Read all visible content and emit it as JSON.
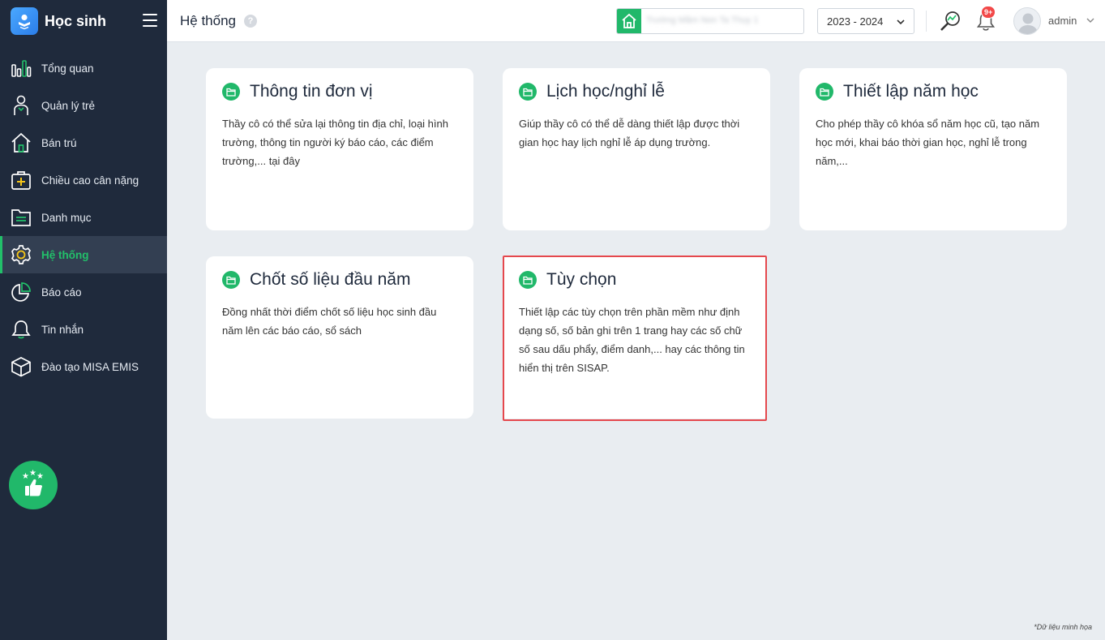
{
  "app": {
    "title": "Học sinh"
  },
  "sidebar": {
    "items": [
      {
        "label": "Tổng quan",
        "icon": "chart-bars-icon"
      },
      {
        "label": "Quản lý trẻ",
        "icon": "child-icon"
      },
      {
        "label": "Bán trú",
        "icon": "house-icon"
      },
      {
        "label": "Chiều cao cân nặng",
        "icon": "medical-kit-icon"
      },
      {
        "label": "Danh mục",
        "icon": "folder-list-icon"
      },
      {
        "label": "Hệ thống",
        "icon": "gear-icon",
        "active": true
      },
      {
        "label": "Báo cáo",
        "icon": "pie-chart-icon"
      },
      {
        "label": "Tin nhắn",
        "icon": "bell-icon"
      },
      {
        "label": "Đào tạo MISA EMIS",
        "icon": "cube-icon"
      }
    ]
  },
  "header": {
    "title": "Hệ thống",
    "help": "?",
    "school_name": "Trường Mầm Non Ta Thụy 1",
    "year": "2023 - 2024",
    "notification_badge": "9+",
    "user": "admin"
  },
  "cards": [
    {
      "title": "Thông tin đơn vị",
      "desc": "Thầy cô có thể sửa lại thông tin địa chỉ, loại hình trường, thông tin người ký báo cáo, các điểm trường,... tại đây"
    },
    {
      "title": "Lịch học/nghỉ lễ",
      "desc": "Giúp thầy cô có thể dễ dàng thiết lập được thời gian học hay lịch nghỉ lễ áp dụng trường."
    },
    {
      "title": "Thiết lập năm học",
      "desc": "Cho phép thầy cô khóa sổ năm học cũ, tạo năm học mới, khai báo thời gian học, nghỉ lễ trong năm,..."
    },
    {
      "title": "Chốt số liệu đầu năm",
      "desc": "Đồng nhất thời điểm chốt số liệu học sinh đầu năm lên các báo cáo, sổ sách"
    },
    {
      "title": "Tùy chọn",
      "desc": "Thiết lập các tùy chọn trên phần mềm như định dạng số, số bản ghi trên 1 trang hay các số chữ số sau dấu phẩy, điểm danh,... hay các thông tin hiển thị trên SISAP."
    }
  ],
  "footnote": "*Dữ liệu minh họa",
  "colors": {
    "sidebar_bg": "#1f2a3c",
    "accent": "#21b86a",
    "highlight": "#e5484d",
    "content_bg": "#e9edf1"
  }
}
